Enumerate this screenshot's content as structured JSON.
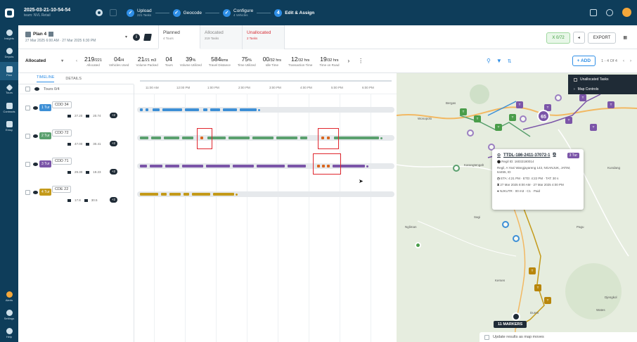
{
  "topbar": {
    "session_title": "2025-03-21-10-54-54",
    "session_sub": "team: NVL Retail",
    "steps": [
      {
        "num": "✓",
        "label": "Upload",
        "sub": "221 Tasks"
      },
      {
        "num": "✓",
        "label": "Geocode",
        "sub": ""
      },
      {
        "num": "✓",
        "label": "Configure",
        "sub": "4 Vehicles"
      },
      {
        "num": "4",
        "label": "Edit & Assign",
        "sub": ""
      }
    ]
  },
  "nav": {
    "items": [
      {
        "label": "Insights"
      },
      {
        "label": "Depots"
      },
      {
        "label": "Plan"
      },
      {
        "label": "Tours"
      },
      {
        "label": "Contracts"
      },
      {
        "label": "Emsy"
      }
    ],
    "bottom": [
      {
        "label": "Alerts"
      },
      {
        "label": "Settings"
      },
      {
        "label": "Help"
      }
    ]
  },
  "plan": {
    "name": "Plan 4",
    "dates": "27 Mar 2025 6:00 AM · 27 Mar 2025 6:30 PM",
    "tabs": [
      {
        "name": "Planned",
        "meta": "4 Tours"
      },
      {
        "name": "Allocated",
        "meta": "219 Tasks"
      },
      {
        "name": "Unallocated",
        "meta": "2 Tasks"
      }
    ],
    "actions": {
      "green_label": "X 0/72",
      "export_label": "EXPORT"
    }
  },
  "stats": {
    "selector": "Allocated",
    "items": [
      {
        "value": "219",
        "unit": "/221",
        "key": "Allocated"
      },
      {
        "value": "04",
        "unit": "/4",
        "key": "Vehicles Used"
      },
      {
        "value": "21",
        "unit": "/21 m3",
        "key": "Volume Packed"
      },
      {
        "value": "04",
        "unit": "",
        "key": "Tours"
      },
      {
        "value": "39",
        "unit": "%",
        "key": "Volume Utilized"
      },
      {
        "value": "584",
        "unit": "kms",
        "key": "Travel Distance"
      },
      {
        "value": "75",
        "unit": "%",
        "key": "Time Utilized"
      },
      {
        "value": "00",
        "unit": "/32 hrs",
        "key": "Idle Time"
      },
      {
        "value": "12",
        "unit": "/32 hrs",
        "key": "Transaction Time"
      },
      {
        "value": "19",
        "unit": "/32 hrs",
        "key": "Time on Road"
      }
    ],
    "add_label": "+ ADD",
    "paging": "1 - 4 Of 4"
  },
  "panel": {
    "subtabs": [
      "TIMELINE",
      "DETAILS"
    ],
    "tours_header": "Tours 0/4",
    "ticks": [
      "11:00 AM",
      "12:00 PM",
      "1:00 PM",
      "2:00 PM",
      "3:00 PM",
      "4:00 PM",
      "5:00 PM",
      "6:00 PM"
    ],
    "rows": [
      {
        "tour": "1 Tur",
        "code": "CDD",
        "num": "34",
        "m1": "27.20",
        "m2": "20.74",
        "badge": "+2",
        "color": "#3d8fd6"
      },
      {
        "tour": "2 Tur",
        "code": "CDD",
        "num": "72",
        "m1": "47.00",
        "m2": "30.41",
        "badge": "+2",
        "color": "#5aa06e"
      },
      {
        "tour": "3 Tur",
        "code": "CDD",
        "num": "71",
        "m1": "29.30",
        "m2": "19.23",
        "badge": "+2",
        "color": "#7b55a8"
      },
      {
        "tour": "4 Tur",
        "code": "CDE",
        "num": "22",
        "m1": "17.8",
        "m2": "30.5",
        "badge": "+2",
        "color": "#c49a1a"
      }
    ]
  },
  "map": {
    "legend": [
      "Unallocated Tasks",
      "Map Controls"
    ],
    "tooltip": {
      "id": "TTDL-186-2411-37072-1",
      "status": "3 Tur",
      "line1": "Regil ID: 16032180014",
      "line2": "Regil, A Yani Wangjayareng 143, NGANJUK, JATIM, 64455, ID",
      "line3": "ETA: 4:21 PM · ETD: 4:22 PM · TAT: 30 s",
      "line4": "27 Mar 2025 8:00 AM · 27 Mar 2025 4:00 PM",
      "line5": "NJKUTR · 00 m3 · C1 · Paid"
    },
    "cluster": "65",
    "markers_label": "11 MARKERS",
    "update_label": "Update results as map moves",
    "places": [
      "Bergas",
      "Wonopolo",
      "Ngliman",
      "Sagi",
      "Kundang",
      "Karangtengah",
      "Pagu",
      "Djengkol",
      "Wates",
      "Kersen",
      "Duren"
    ]
  }
}
